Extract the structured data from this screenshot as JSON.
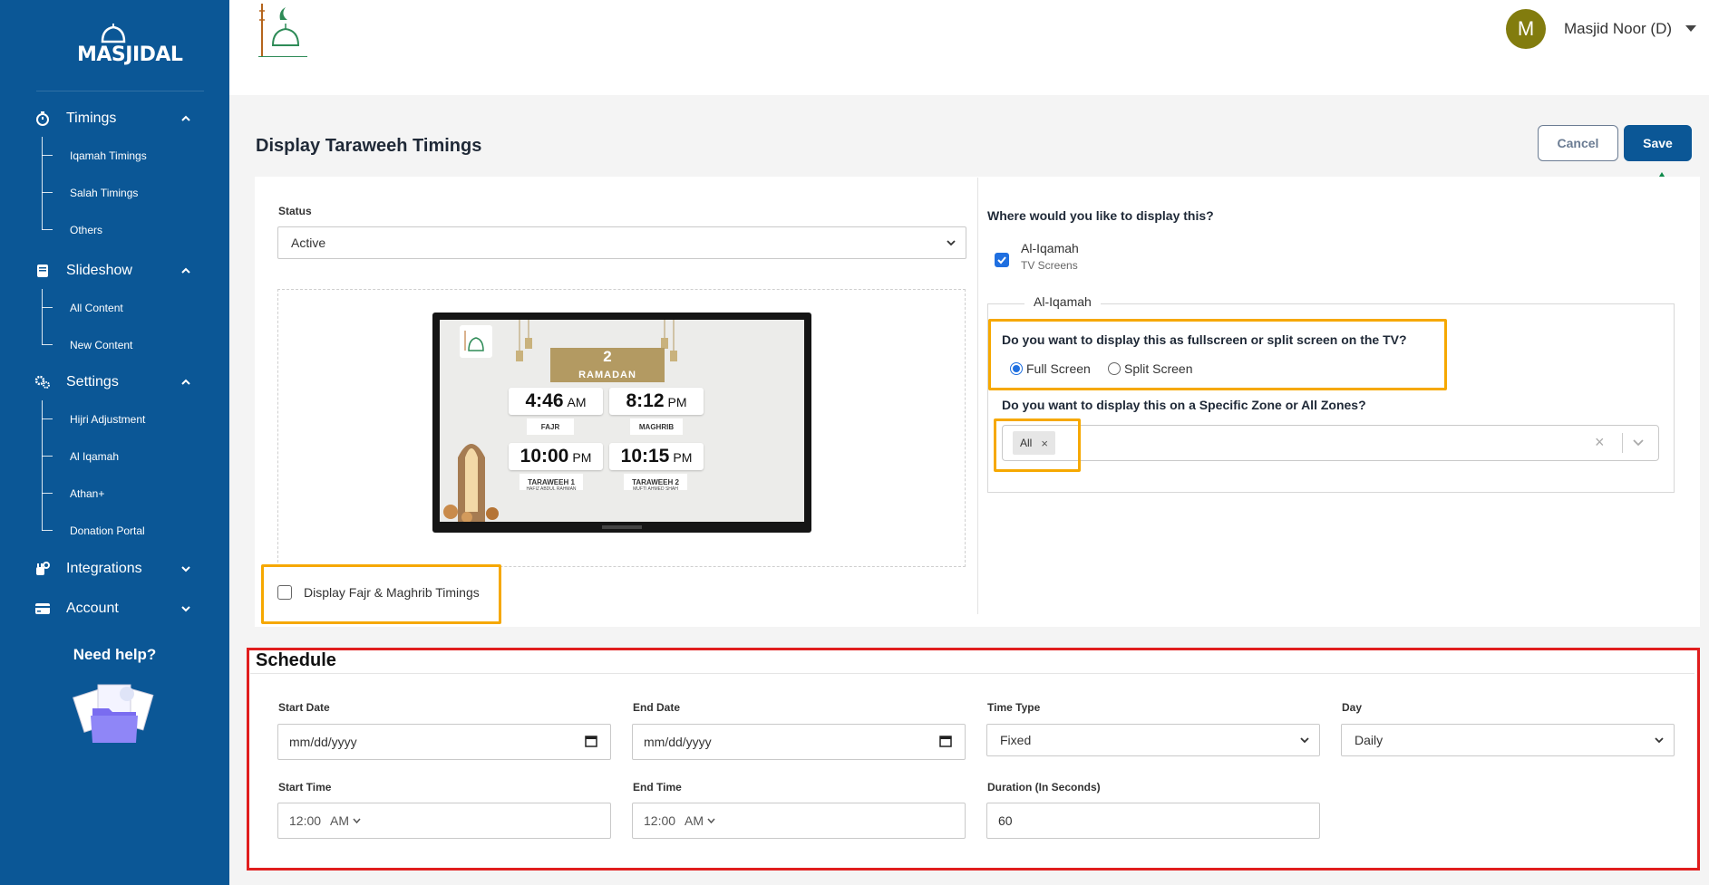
{
  "sidebar": {
    "logo_text": "MASJIDAL",
    "sections": [
      {
        "label": "Timings",
        "items": [
          "Iqamah Timings",
          "Salah Timings",
          "Others"
        ]
      },
      {
        "label": "Slideshow",
        "items": [
          "All Content",
          "New Content"
        ]
      },
      {
        "label": "Settings",
        "items": [
          "Hijri Adjustment",
          "Al Iqamah",
          "Athan+",
          "Donation Portal"
        ]
      },
      {
        "label": "Integrations",
        "items": []
      },
      {
        "label": "Account",
        "items": []
      }
    ],
    "help_title": "Need help?"
  },
  "topbar": {
    "brand_name": "Masjid Noor",
    "avatar_initial": "M",
    "user_name": "Masjid Noor (D)"
  },
  "page": {
    "title": "Display Taraweeh Timings",
    "cancel_label": "Cancel",
    "save_label": "Save"
  },
  "form": {
    "status_label": "Status",
    "status_value": "Active",
    "fajr_maghrib_label": "Display Fajr & Maghrib Timings",
    "fajr_maghrib_checked": false,
    "display_where_label": "Where would you like to display this?",
    "target_name": "Al-Iqamah",
    "target_sub": "TV Screens",
    "target_checked": true,
    "fieldset_legend": "Al-Iqamah",
    "screen_question": "Do you want to display this as fullscreen or split screen on the TV?",
    "screen_options": [
      "Full Screen",
      "Split Screen"
    ],
    "screen_selected": "Full Screen",
    "zone_question": "Do you want to display this on a Specific Zone or All Zones?",
    "zone_chip": "All"
  },
  "preview": {
    "hijri_day": "2",
    "hijri_month": "RAMADAN",
    "times": [
      {
        "time": "4:46",
        "ampm": "AM",
        "name": "FAJR",
        "sub": ""
      },
      {
        "time": "8:12",
        "ampm": "PM",
        "name": "MAGHRIB",
        "sub": ""
      },
      {
        "time": "10:00",
        "ampm": "PM",
        "name": "TARAWEEH 1",
        "sub": "HAFIZ ABDUL RAHMAN"
      },
      {
        "time": "10:15",
        "ampm": "PM",
        "name": "TARAWEEH 2",
        "sub": "MUFTI AHMED SHAH"
      }
    ]
  },
  "schedule": {
    "title": "Schedule",
    "start_date_label": "Start Date",
    "start_date_value": "mm/dd/yyyy",
    "end_date_label": "End Date",
    "end_date_value": "mm/dd/yyyy",
    "time_type_label": "Time Type",
    "time_type_value": "Fixed",
    "day_label": "Day",
    "day_value": "Daily",
    "start_time_label": "Start Time",
    "start_time_value": "12:00",
    "start_time_ampm": "AM",
    "end_time_label": "End Time",
    "end_time_value": "12:00",
    "end_time_ampm": "AM",
    "duration_label": "Duration (In Seconds)",
    "duration_value": "60"
  },
  "colors": {
    "sidebar_bg": "#0b5796",
    "primary": "#0b5796",
    "highlight_yellow": "#f6a800",
    "highlight_red": "#e01e1e",
    "arrow_green": "#0e8a4a",
    "avatar_bg": "#827c0e"
  }
}
